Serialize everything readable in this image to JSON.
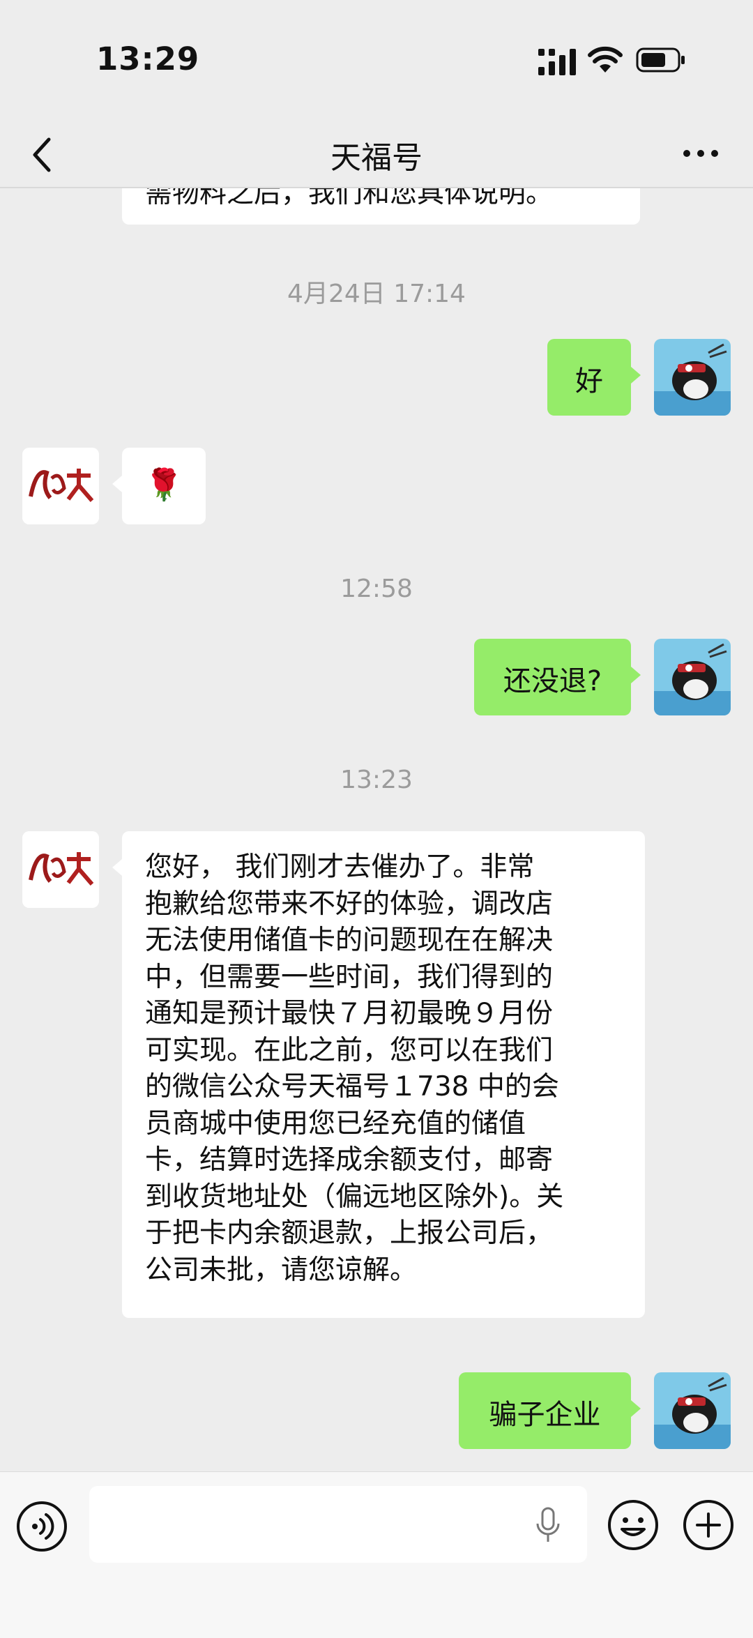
{
  "status": {
    "time": "13:29"
  },
  "nav": {
    "title": "天福号"
  },
  "messages": {
    "partial_text": "需物料之后，我们和您具体说明。",
    "ts1": "4月24日 17:14",
    "m1": "好",
    "m2_emoji": "🌹",
    "ts2": "12:58",
    "m3": "还没退?",
    "ts3": "13:23",
    "m4_lines": [
      "您好， 我们刚才去催办了。非常",
      "抱歉给您带来不好的体验，调改店",
      "无法使用储值卡的问题现在在解决",
      "中，但需要一些时间，我们得到的",
      "通知是预计最快７月初最晚９月份",
      "可实现。在此之前，您可以在我们",
      "的微信公众号天福号１738 中的会",
      "员商城中使用您已经充值的储值",
      "卡，结算时选择成余额支付，邮寄",
      "到收货地址处（偏远地区除外)。关",
      "于把卡内余额退款，上报公司后，",
      "公司未批，请您谅解。"
    ],
    "m5": "骗子企业"
  },
  "icons": {
    "back": "chevron-left-icon",
    "more": "more-dots-icon",
    "voice": "voice-icon",
    "mic": "microphone-icon",
    "emoji": "emoji-icon",
    "plus": "plus-icon"
  },
  "colors": {
    "sent_bubble": "#95ec69",
    "received_bubble": "#ffffff",
    "background": "#ededed"
  }
}
